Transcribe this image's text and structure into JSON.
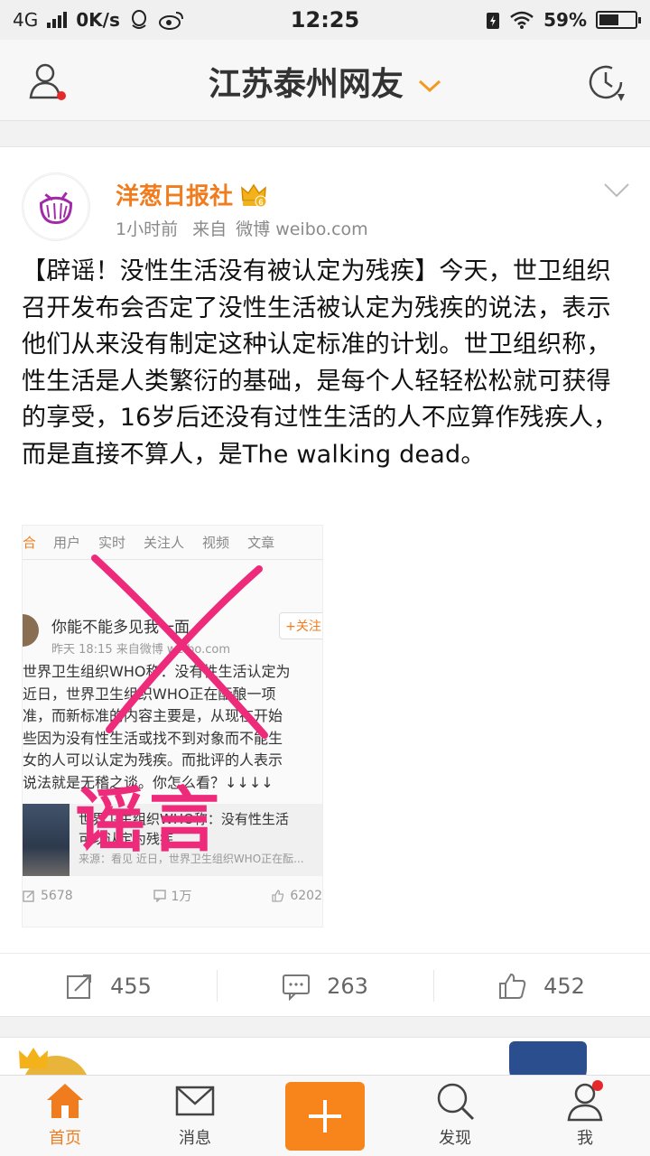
{
  "status_bar": {
    "network": "4G",
    "speed": "0K/s",
    "time": "12:25",
    "battery": "59%",
    "battery_level": 0.59,
    "icons": [
      "signal-icon",
      "qq-icon",
      "weibo-icon",
      "battery-saver-icon",
      "wifi-icon",
      "battery-icon"
    ]
  },
  "header": {
    "title": "江苏泰州网友",
    "icons": [
      "user-icon",
      "chevron-down-icon",
      "refresh-icon"
    ]
  },
  "post": {
    "author": "洋葱日报社",
    "time": "1小时前",
    "source_prefix": "来自",
    "source": "微博 weibo.com",
    "text": "【辟谣！没性生活没有被认定为残疾】今天，世卫组织召开发布会否定了没性生活被认定为残疾的说法，表示他们从来没有制定这种认定标准的计划。世卫组织称，性生活是人类繁衍的基础，是每个人轻轻松松就可获得的享受，16岁后还没有过性生活的人不应算作残疾人，而是直接不算人，是The walking dead。",
    "image": {
      "tabs": [
        "合",
        "用户",
        "实时",
        "关注人",
        "视频",
        "文章"
      ],
      "inner_author": "你能不能多见我一面",
      "follow_label": "+关注",
      "inner_meta": "昨天 18:15  来自微博 weibo.com",
      "body_lines": [
        "世界卫生组织WHO称：没有性生活认定为",
        "近日，世界卫生组织WHO正在酝酿一项",
        "准，而新标准的内容主要是，从现在开始",
        "些因为没有性生活或找不到对象而不能生",
        "女的人可以认定为残疾。而批评的人表示",
        "说法就是无稽之谈。你怎么看？↓↓↓↓"
      ],
      "quote_title": "世界卫生组织WHO称：没有性生活",
      "quote_title2": "可以认定为残疾",
      "quote_source": "来源：看见 近日，世界卫生组织WHO正在酝...",
      "repost": "5678",
      "comment": "1万",
      "like": "6202",
      "stamp": "谣言",
      "stamp_color": "#ee2a7b"
    },
    "actions": {
      "repost": "455",
      "comment": "263",
      "like": "452"
    }
  },
  "tabbar": {
    "home": "首页",
    "messages": "消息",
    "discover": "发现",
    "me": "我",
    "accent": "#f07c1e"
  }
}
